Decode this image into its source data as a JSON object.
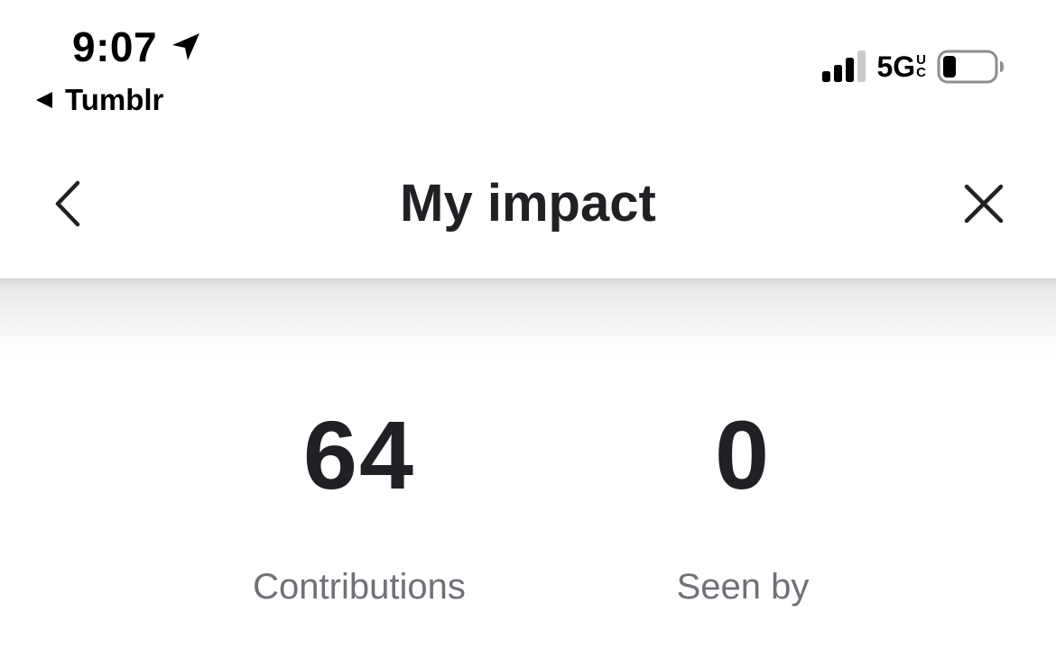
{
  "status_bar": {
    "time": "9:07",
    "back_app": "Tumblr",
    "network": "5G",
    "network_sup_top": "U",
    "network_sup_bottom": "C",
    "icons": [
      "location-arrow-icon",
      "back-triangle-icon",
      "cellular-signal-icon",
      "battery-icon"
    ],
    "signal_bars_filled": 3,
    "signal_bars_total": 4,
    "battery_level": 0.2
  },
  "nav": {
    "title": "My impact",
    "back_icon": "chevron-left-icon",
    "close_icon": "close-icon"
  },
  "stats": [
    {
      "value": "64",
      "label": "Contributions"
    },
    {
      "value": "0",
      "label": "Seen by"
    }
  ],
  "colors": {
    "background": "#ffffff",
    "text_primary": "#202124",
    "text_secondary": "#6f7178"
  }
}
